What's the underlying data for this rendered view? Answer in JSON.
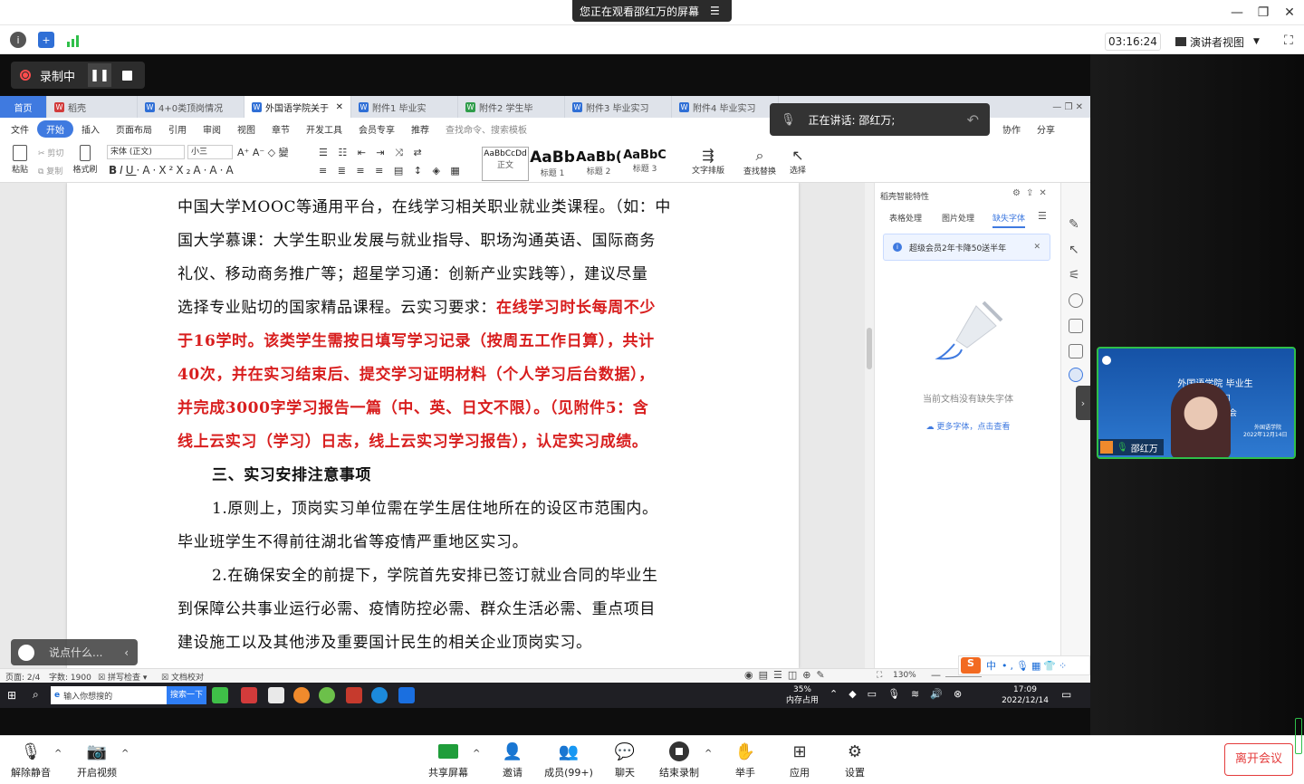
{
  "meeting": {
    "share_banner": "您正在观看邵红万的屏幕",
    "timer": "03:16:24",
    "presenter_view": "演讲者视图",
    "recording": "录制中",
    "speaking": "正在讲话: 邵红万;",
    "participant_name": "邵红万",
    "video_title": "外国语学院 毕业生",
    "video_lines": [
      "顶岗 习",
      "毕业论文 员大会"
    ],
    "video_sub": [
      "外国语学院",
      "2022年12月14日"
    ],
    "chat_placeholder": "说点什么...",
    "bottom": {
      "mute": "解除静音",
      "video": "开启视频",
      "share": "共享屏幕",
      "invite": "邀请",
      "members": "成员(99+)",
      "chat": "聊天",
      "end_rec": "结束录制",
      "raise": "举手",
      "apps": "应用",
      "settings": "设置",
      "leave": "离开会议"
    }
  },
  "wps": {
    "tabs": [
      {
        "label": "首页",
        "type": "home"
      },
      {
        "label": "稻壳",
        "type": "red"
      },
      {
        "label": "4+0类顶岗情况",
        "type": "blue"
      },
      {
        "label": "外国语学院关于",
        "type": "active"
      },
      {
        "label": "附件1 毕业实",
        "type": "blue"
      },
      {
        "label": "附件2 学生毕",
        "type": "green"
      },
      {
        "label": "附件3 毕业实习",
        "type": "blue"
      },
      {
        "label": "附件4 毕业实习",
        "type": "blue"
      }
    ],
    "menu": [
      "文件",
      "开始",
      "插入",
      "页面布局",
      "引用",
      "审阅",
      "视图",
      "章节",
      "开发工具",
      "会员专享",
      "推荐",
      "查找命令、搜索模板"
    ],
    "menu_right": [
      "协作",
      "分享"
    ],
    "ribbon": {
      "paste": "粘贴",
      "cut": "剪切",
      "copy": "复制",
      "format_painter": "格式刷",
      "font": "宋体 (正文)",
      "size": "小三",
      "styles": [
        {
          "preview": "AaBbCcDd",
          "name": "正文"
        },
        {
          "preview": "AaBb",
          "name": "标题 1"
        },
        {
          "preview": "AaBb(",
          "name": "标题 2"
        },
        {
          "preview": "AaBbC",
          "name": "标题 3"
        }
      ],
      "text_layout": "文字排版",
      "find_replace": "查找替换",
      "select": "选择"
    },
    "doc_lines": [
      {
        "segs": [
          {
            "t": "中国大学MOOC等通用平台，在线学习相关职业就业类课程。（如：中",
            "r": false
          }
        ]
      },
      {
        "segs": [
          {
            "t": "国大学慕课：大学生职业发展与就业指导、职场沟通英语、国际商务",
            "r": false
          }
        ]
      },
      {
        "segs": [
          {
            "t": "礼仪、移动商务推广等；超星学习通：创新产业实践等），建议尽量",
            "r": false
          }
        ]
      },
      {
        "segs": [
          {
            "t": "选择专业贴切的国家精品课程。云实习要求：",
            "r": false
          },
          {
            "t": "在线学习时长每周不少",
            "r": true
          }
        ]
      },
      {
        "segs": [
          {
            "t": "于16学时。该类学生需按日填写学习记录（按周五工作日算），共计",
            "r": true
          }
        ]
      },
      {
        "segs": [
          {
            "t": "40次，并在实习结束后、提交学习证明材料（个人学习后台数据），",
            "r": true
          }
        ]
      },
      {
        "segs": [
          {
            "t": "并完成3000字学习报告一篇（中、英、日文不限）。（见附件5：含",
            "r": true
          }
        ]
      },
      {
        "segs": [
          {
            "t": "线上云实习（学习）日志，线上云实习学习报告），认定实习成绩。",
            "r": true
          }
        ]
      },
      {
        "segs": [
          {
            "t": "三、实习安排注意事项",
            "r": false,
            "b": true
          }
        ],
        "indent": true
      },
      {
        "segs": [
          {
            "t": "1.原则上，顶岗实习单位需在学生居住地所在的设区市范围内。",
            "r": false
          }
        ],
        "indent": true
      },
      {
        "segs": [
          {
            "t": "毕业班学生不得前往湖北省等疫情严重地区实习。",
            "r": false
          }
        ]
      },
      {
        "segs": [
          {
            "t": "2.在确保安全的前提下，学院首先安排已签订就业合同的毕业生",
            "r": false
          }
        ],
        "indent": true
      },
      {
        "segs": [
          {
            "t": "到保障公共事业运行必需、疫情防控必需、群众生活必需、重点项目",
            "r": false
          }
        ]
      },
      {
        "segs": [
          {
            "t": "建设施工以及其他涉及重要国计民生的相关企业顶岗实习。",
            "r": false
          }
        ]
      }
    ],
    "side_panel": {
      "title": "稻壳智能特性",
      "tabs": [
        "表格处理",
        "图片处理",
        "缺失字体"
      ],
      "notice": "超级会员2年卡降50送半年",
      "empty": "当前文档没有缺失字体",
      "more": "更多字体，点击查看"
    },
    "status": {
      "page": "页面: 2/4",
      "words": "字数: 1900",
      "spell": "拼写检查",
      "proof": "文档校对",
      "zoom": "130%"
    }
  },
  "taskbar": {
    "search": "输入你想搜的",
    "search_btn": "搜索一下",
    "mem_pct": "35%",
    "mem_label": "内存占用",
    "ime": "中",
    "time": "17:09",
    "date": "2022/12/14"
  }
}
